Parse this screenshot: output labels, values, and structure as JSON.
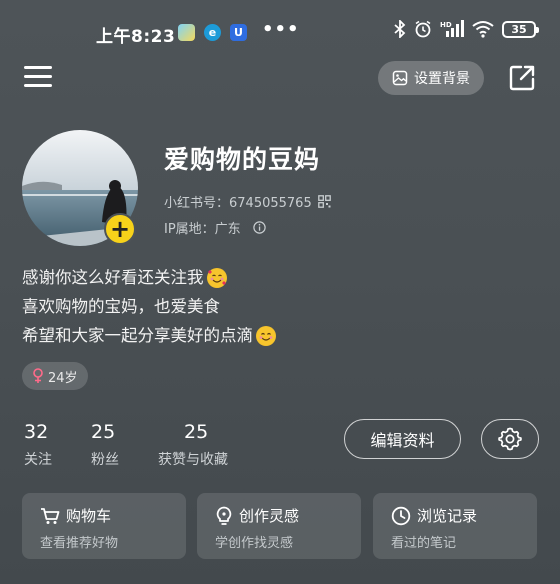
{
  "status_bar": {
    "time": "上午8:23",
    "more": "•••",
    "network_label": "HD",
    "battery": "35"
  },
  "header": {
    "set_background_label": "设置背景"
  },
  "profile": {
    "nickname": "爱购物的豆妈",
    "id_label": "小红书号：6745055765",
    "ip_label": "IP属地：广东",
    "bio": [
      "感谢你这么好看还关注我",
      "喜欢购物的宝妈，也爱美食",
      "希望和大家一起分享美好的点滴"
    ],
    "age": "24岁"
  },
  "stats": [
    {
      "value": "32",
      "label": "关注"
    },
    {
      "value": "25",
      "label": "粉丝"
    },
    {
      "value": "25",
      "label": "获赞与收藏"
    }
  ],
  "actions": {
    "edit_profile": "编辑资料"
  },
  "shortcuts": [
    {
      "title": "购物车",
      "subtitle": "查看推荐好物",
      "icon": "cart-icon"
    },
    {
      "title": "创作灵感",
      "subtitle": "学创作找灵感",
      "icon": "lightbulb-icon"
    },
    {
      "title": "浏览记录",
      "subtitle": "看过的笔记",
      "icon": "clock-icon"
    }
  ],
  "colors": {
    "background": "#4a5054",
    "accent_yellow": "#f7d21a",
    "female_symbol": "#ff6b8a"
  }
}
